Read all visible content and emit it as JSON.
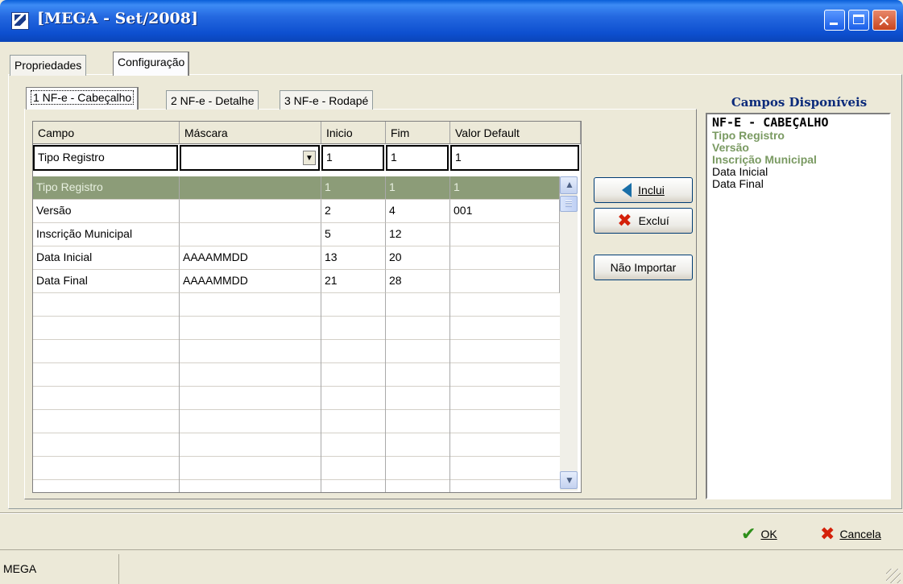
{
  "window": {
    "title": "[MEGA - Set/2008]"
  },
  "outer_tabs": [
    {
      "label": "Propriedades",
      "active": false
    },
    {
      "label": "Configuração",
      "active": true
    }
  ],
  "inner_tabs": [
    {
      "label": "1 NF-e - Cabeçalho",
      "active": true
    },
    {
      "label": "2 NF-e - Detalhe",
      "active": false
    },
    {
      "label": "3 NF-e - Rodapé",
      "active": false
    }
  ],
  "grid": {
    "columns": [
      "Campo",
      "Máscara",
      "Inicio",
      "Fim",
      "Valor Default"
    ],
    "edit_row": {
      "campo": "Tipo Registro",
      "mascara": "",
      "inicio": "1",
      "fim": "1",
      "valor_default": "1"
    },
    "rows": [
      {
        "campo": "Tipo Registro",
        "mascara": "",
        "inicio": "1",
        "fim": "1",
        "valor_default": "1",
        "selected": true
      },
      {
        "campo": "Versão",
        "mascara": "",
        "inicio": "2",
        "fim": "4",
        "valor_default": "001"
      },
      {
        "campo": "Inscrição Municipal",
        "mascara": "",
        "inicio": "5",
        "fim": "12",
        "valor_default": ""
      },
      {
        "campo": "Data Inicial",
        "mascara": "AAAAMMDD",
        "inicio": "13",
        "fim": "20",
        "valor_default": ""
      },
      {
        "campo": "Data Final",
        "mascara": "AAAAMMDD",
        "inicio": "21",
        "fim": "28",
        "valor_default": ""
      }
    ]
  },
  "actions": {
    "include": "Inclui",
    "exclude": "Excluí",
    "no_import": "Não Importar"
  },
  "available_fields": {
    "title": "Campos Disponíveis",
    "items": [
      {
        "label": "NF-E - CABEÇALHO",
        "kind": "heading"
      },
      {
        "label": "Tipo Registro",
        "kind": "used"
      },
      {
        "label": "Versão",
        "kind": "used"
      },
      {
        "label": "Inscrição Municipal",
        "kind": "used"
      },
      {
        "label": "Data Inicial",
        "kind": "available"
      },
      {
        "label": "Data Final",
        "kind": "available"
      }
    ]
  },
  "footer": {
    "ok": "OK",
    "cancel": "Cancela"
  },
  "status_bar": {
    "panel1": "MEGA"
  },
  "colors": {
    "selected_row": "#8c9c78",
    "used_field": "#7a9a62",
    "titlebar": "#0d4fcf"
  }
}
